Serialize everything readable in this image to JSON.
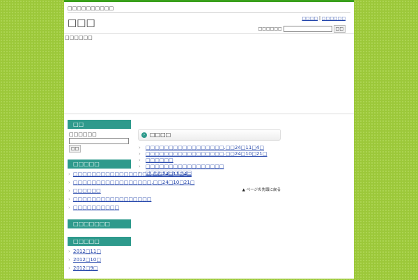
{
  "header": {
    "tagline": "□□□□□□□□□□",
    "title": "□□□",
    "nav": [
      "□□□□",
      "□□□□□□"
    ],
    "search_label": "□□□□□□",
    "search_value": "",
    "search_button": "□□",
    "description": "□□□□□□"
  },
  "sidebar": {
    "search": {
      "title": "□□",
      "label": "□□□□□□",
      "button": "□□"
    },
    "recent": {
      "title": "□□□□□",
      "items": [
        "□□□□□□□□□□□□□□□□□.□□24□11□4□",
        "□□□□□□□□□□□□□□□□□.□□24□10□21□",
        "□□□□□□",
        "□□□□□□□□□□□□□□□□□",
        "□□□□□□□□□□"
      ]
    },
    "comments": {
      "title": "□□□□□□□"
    },
    "archives": {
      "title": "□□□□□",
      "items": [
        "2012□11□",
        "2012□10□",
        "2012□9□"
      ]
    }
  },
  "main": {
    "title": "□□□□",
    "items": [
      "□□□□□□□□□□□□□□□□□.□□24□11□4□",
      "□□□□□□□□□□□□□□□□□.□□24□10□21□",
      "□□□□□□",
      "□□□□□□□□□□□□□□□□□",
      "□□□□□□□□□□"
    ],
    "back_to_top": "▲ ページの先頭に戻る"
  }
}
